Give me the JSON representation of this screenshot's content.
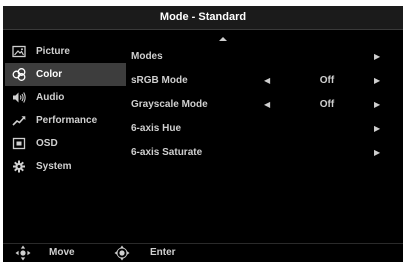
{
  "title": "Mode - Standard",
  "sidebar": {
    "items": [
      {
        "label": "Picture",
        "icon": "picture-icon",
        "selected": false
      },
      {
        "label": "Color",
        "icon": "color-palette-icon",
        "selected": true
      },
      {
        "label": "Audio",
        "icon": "speaker-icon",
        "selected": false
      },
      {
        "label": "Performance",
        "icon": "performance-graph-icon",
        "selected": false
      },
      {
        "label": "OSD",
        "icon": "osd-icon",
        "selected": false
      },
      {
        "label": "System",
        "icon": "gear-icon",
        "selected": false
      }
    ]
  },
  "options": [
    {
      "label": "Modes",
      "has_left": false,
      "value": "",
      "arrow": "▶"
    },
    {
      "label": "sRGB Mode",
      "has_left": true,
      "value": "Off",
      "arrow": "▶"
    },
    {
      "label": "Grayscale Mode",
      "has_left": true,
      "value": "Off",
      "arrow": "▶"
    },
    {
      "label": "6-axis Hue",
      "has_left": false,
      "value": "",
      "arrow": "▶"
    },
    {
      "label": "6-axis Saturate",
      "has_left": false,
      "value": "",
      "arrow": "▶"
    }
  ],
  "left_arrow": "◀",
  "footer": {
    "move_label": "Move",
    "enter_label": "Enter"
  },
  "colors": {
    "background": "#000000",
    "selected_row": "#3d3d3d",
    "title_bar": "#1b1b1b",
    "text": "#d0d0d0"
  }
}
